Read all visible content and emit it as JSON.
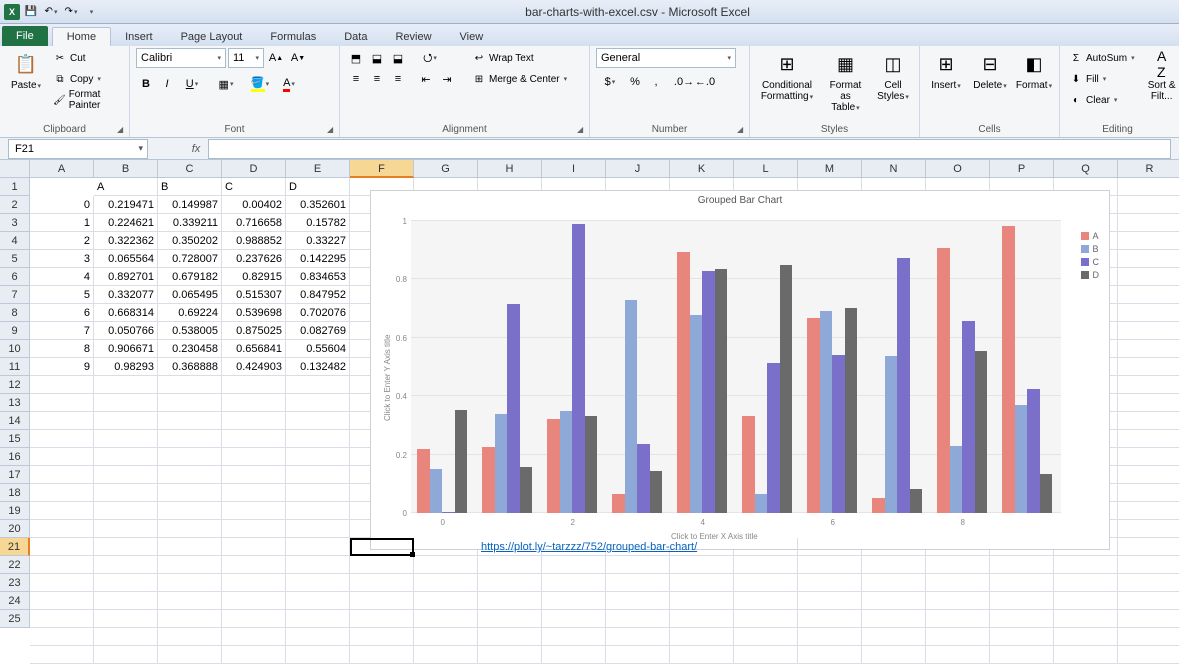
{
  "title": "bar-charts-with-excel.csv - Microsoft Excel",
  "tabs": {
    "file": "File",
    "list": [
      "Home",
      "Insert",
      "Page Layout",
      "Formulas",
      "Data",
      "Review",
      "View"
    ],
    "active": "Home"
  },
  "clipboard": {
    "paste": "Paste",
    "cut": "Cut",
    "copy": "Copy",
    "painter": "Format Painter",
    "group": "Clipboard"
  },
  "font": {
    "name": "Calibri",
    "size": "11",
    "group": "Font"
  },
  "alignment": {
    "wrap": "Wrap Text",
    "merge": "Merge & Center",
    "group": "Alignment"
  },
  "number": {
    "format": "General",
    "group": "Number"
  },
  "styles": {
    "cond": "Conditional Formatting",
    "table": "Format as Table",
    "cell": "Cell Styles",
    "group": "Styles"
  },
  "cells_group": {
    "insert": "Insert",
    "delete": "Delete",
    "format": "Format",
    "group": "Cells"
  },
  "editing": {
    "autosum": "AutoSum",
    "fill": "Fill",
    "clear": "Clear",
    "sort": "Sort & Filt...",
    "group": "Editing"
  },
  "namebox": "F21",
  "columns": [
    "A",
    "B",
    "C",
    "D",
    "E",
    "F",
    "G",
    "H",
    "I",
    "J",
    "K",
    "L",
    "M",
    "N",
    "O",
    "P",
    "Q",
    "R"
  ],
  "headers": {
    "c1": "A",
    "c2": "B",
    "c3": "C",
    "c4": "D"
  },
  "data_rows": [
    {
      "i": "0",
      "a": "0.219471",
      "b": "0.149987",
      "c": "0.00402",
      "d": "0.352601"
    },
    {
      "i": "1",
      "a": "0.224621",
      "b": "0.339211",
      "c": "0.716658",
      "d": "0.15782"
    },
    {
      "i": "2",
      "a": "0.322362",
      "b": "0.350202",
      "c": "0.988852",
      "d": "0.33227"
    },
    {
      "i": "3",
      "a": "0.065564",
      "b": "0.728007",
      "c": "0.237626",
      "d": "0.142295"
    },
    {
      "i": "4",
      "a": "0.892701",
      "b": "0.679182",
      "c": "0.82915",
      "d": "0.834653"
    },
    {
      "i": "5",
      "a": "0.332077",
      "b": "0.065495",
      "c": "0.515307",
      "d": "0.847952"
    },
    {
      "i": "6",
      "a": "0.668314",
      "b": "0.69224",
      "c": "0.539698",
      "d": "0.702076"
    },
    {
      "i": "7",
      "a": "0.050766",
      "b": "0.538005",
      "c": "0.875025",
      "d": "0.082769"
    },
    {
      "i": "8",
      "a": "0.906671",
      "b": "0.230458",
      "c": "0.656841",
      "d": "0.55604"
    },
    {
      "i": "9",
      "a": "0.98293",
      "b": "0.368888",
      "c": "0.424903",
      "d": "0.132482"
    }
  ],
  "link": "https://plot.ly/~tarzzz/752/grouped-bar-chart/",
  "chart_data": {
    "type": "bar",
    "title": "Grouped Bar Chart",
    "xlabel": "Click to Enter X Axis title",
    "ylabel": "Click to Enter Y Axis title",
    "categories": [
      "0",
      "1",
      "2",
      "3",
      "4",
      "5",
      "6",
      "7",
      "8",
      "9"
    ],
    "ylim": [
      0,
      1
    ],
    "yticks": [
      0,
      0.2,
      0.4,
      0.6,
      0.8,
      1
    ],
    "xtick_positions": [
      0,
      2,
      4,
      6,
      8
    ],
    "series": [
      {
        "name": "A",
        "color": "#e8857c",
        "values": [
          0.219471,
          0.224621,
          0.322362,
          0.065564,
          0.892701,
          0.332077,
          0.668314,
          0.050766,
          0.906671,
          0.98293
        ]
      },
      {
        "name": "B",
        "color": "#8ea8d8",
        "values": [
          0.149987,
          0.339211,
          0.350202,
          0.728007,
          0.679182,
          0.065495,
          0.69224,
          0.538005,
          0.230458,
          0.368888
        ]
      },
      {
        "name": "C",
        "color": "#7a6fc9",
        "values": [
          0.00402,
          0.716658,
          0.988852,
          0.237626,
          0.82915,
          0.515307,
          0.539698,
          0.875025,
          0.656841,
          0.424903
        ]
      },
      {
        "name": "D",
        "color": "#6a6a6a",
        "values": [
          0.352601,
          0.15782,
          0.33227,
          0.142295,
          0.834653,
          0.847952,
          0.702076,
          0.082769,
          0.55604,
          0.132482
        ]
      }
    ]
  }
}
